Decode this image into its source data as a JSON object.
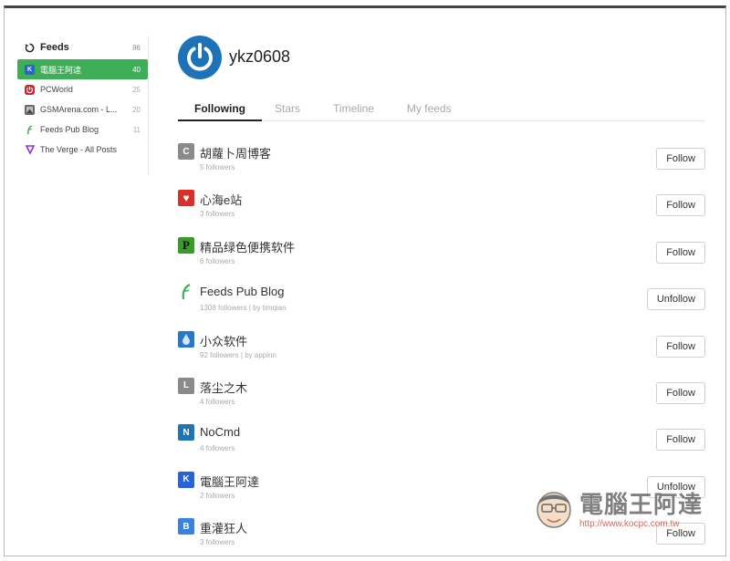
{
  "sidebar": {
    "header": {
      "label": "Feeds",
      "count": "96",
      "icon": "refresh-icon"
    },
    "items": [
      {
        "label": "電腦王阿達",
        "count": "40",
        "icon": "K",
        "color": "#2a62d8",
        "active": true
      },
      {
        "label": "PCWorld",
        "count": "25",
        "icon": "power-icon",
        "color": "#d22630"
      },
      {
        "label": "GSMArena.com - L...",
        "count": "20",
        "icon": "gsmarena-icon",
        "color": "#666666"
      },
      {
        "label": "Feeds Pub Blog",
        "count": "11",
        "icon": "leaf-icon",
        "color": "#3fae58"
      },
      {
        "label": "The Verge - All Posts",
        "count": "",
        "icon": "verge-icon",
        "color": "#8b2fd1"
      }
    ]
  },
  "profile": {
    "username": "ykz0608",
    "avatar_color": "#1e73b8"
  },
  "tabs": [
    {
      "label": "Following",
      "active": true
    },
    {
      "label": "Stars"
    },
    {
      "label": "Timeline"
    },
    {
      "label": "My feeds"
    }
  ],
  "feeds": [
    {
      "title": "胡蘿卜周博客",
      "meta": "5 followers",
      "icon_text": "C",
      "icon_color": "#8a8a8a",
      "button": "Follow"
    },
    {
      "title": "心海e站",
      "meta": "3 followers",
      "icon_text": "♥",
      "icon_color": "#d9302c",
      "button": "Follow"
    },
    {
      "title": "精品绿色便携软件",
      "meta": "6 followers",
      "icon_text": "P",
      "icon_color": "#3a9a2a",
      "button": "Follow"
    },
    {
      "title": "Feeds Pub Blog",
      "meta": "1308 followers | by timqian",
      "icon_text": "",
      "icon_color": "#3fae58",
      "button": "Unfollow"
    },
    {
      "title": "小众软件",
      "meta": "92 followers | by appinn",
      "icon_text": "💧",
      "icon_color": "#2678c6",
      "button": "Follow"
    },
    {
      "title": "落尘之木",
      "meta": "4 followers",
      "icon_text": "L",
      "icon_color": "#8a8a8a",
      "button": "Follow"
    },
    {
      "title": "NoCmd",
      "meta": "4 followers",
      "icon_text": "N",
      "icon_color": "#1f74b5",
      "button": "Follow"
    },
    {
      "title": "電腦王阿達",
      "meta": "2 followers",
      "icon_text": "K",
      "icon_color": "#2a62d8",
      "button": "Unfollow"
    },
    {
      "title": "重灌狂人",
      "meta": "3 followers",
      "icon_text": "B",
      "icon_color": "#3b82e0",
      "button": "Follow"
    }
  ],
  "watermark": {
    "title": "電腦王阿達",
    "url": "http://www.kocpc.com.tw"
  }
}
